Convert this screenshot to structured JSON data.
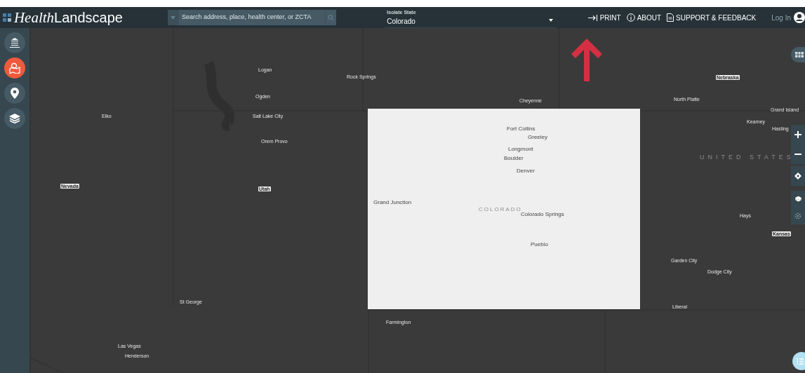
{
  "header": {
    "brand_italic": "Health",
    "brand_rest": "Landscape",
    "search": {
      "placeholder": "Search address, place, health center, or ZCTA"
    },
    "state_select": {
      "label": "Isolate State",
      "value": "Colorado"
    },
    "nav": [
      {
        "kind": "print",
        "label": "PRINT"
      },
      {
        "kind": "about",
        "label": "ABOUT"
      },
      {
        "kind": "support",
        "label": "SUPPORT & FEEDBACK"
      }
    ],
    "login": "Log In"
  },
  "sidebar": [
    {
      "kind": "library",
      "selected": false
    },
    {
      "kind": "map",
      "selected": true
    },
    {
      "kind": "pin",
      "selected": false
    },
    {
      "kind": "layers",
      "selected": false
    }
  ],
  "map_labels": [
    {
      "text": "Logan",
      "kind": "city"
    },
    {
      "text": "Ogden",
      "kind": "city"
    },
    {
      "text": "Salt Lake City",
      "kind": "city"
    },
    {
      "text": "Orem Provo",
      "kind": "city"
    },
    {
      "text": "Utah",
      "kind": "state"
    },
    {
      "text": "Nevada",
      "kind": "state"
    },
    {
      "text": "Elko",
      "kind": "city"
    },
    {
      "text": "St George",
      "kind": "city"
    },
    {
      "text": "Las Vegas",
      "kind": "city"
    },
    {
      "text": "Henderson",
      "kind": "city"
    },
    {
      "text": "Rock Springs",
      "kind": "city"
    },
    {
      "text": "Cheyenne",
      "kind": "city"
    },
    {
      "text": "Nebraska",
      "kind": "state"
    },
    {
      "text": "North Platte",
      "kind": "city"
    },
    {
      "text": "Grand Island",
      "kind": "city"
    },
    {
      "text": "Kearney",
      "kind": "city"
    },
    {
      "text": "Hasting",
      "kind": "city"
    },
    {
      "text": "UNITED STATES",
      "kind": "region"
    },
    {
      "text": "Hays",
      "kind": "city"
    },
    {
      "text": "Kansas",
      "kind": "state"
    },
    {
      "text": "Garden City",
      "kind": "city"
    },
    {
      "text": "Dodge City",
      "kind": "city"
    },
    {
      "text": "Liberal",
      "kind": "city"
    },
    {
      "text": "Farmington",
      "kind": "city"
    },
    {
      "text": "Fort Collins",
      "kind": "focus_city"
    },
    {
      "text": "Greeley",
      "kind": "focus_city"
    },
    {
      "text": "Longmont",
      "kind": "focus_city"
    },
    {
      "text": "Boulder",
      "kind": "focus_city"
    },
    {
      "text": "Denver",
      "kind": "focus_city"
    },
    {
      "text": "Grand Junction",
      "kind": "focus_city"
    },
    {
      "text": "COLORADO",
      "kind": "focus_region"
    },
    {
      "text": "Colorado Springs",
      "kind": "focus_city"
    },
    {
      "text": "Pueblo",
      "kind": "focus_city"
    }
  ]
}
